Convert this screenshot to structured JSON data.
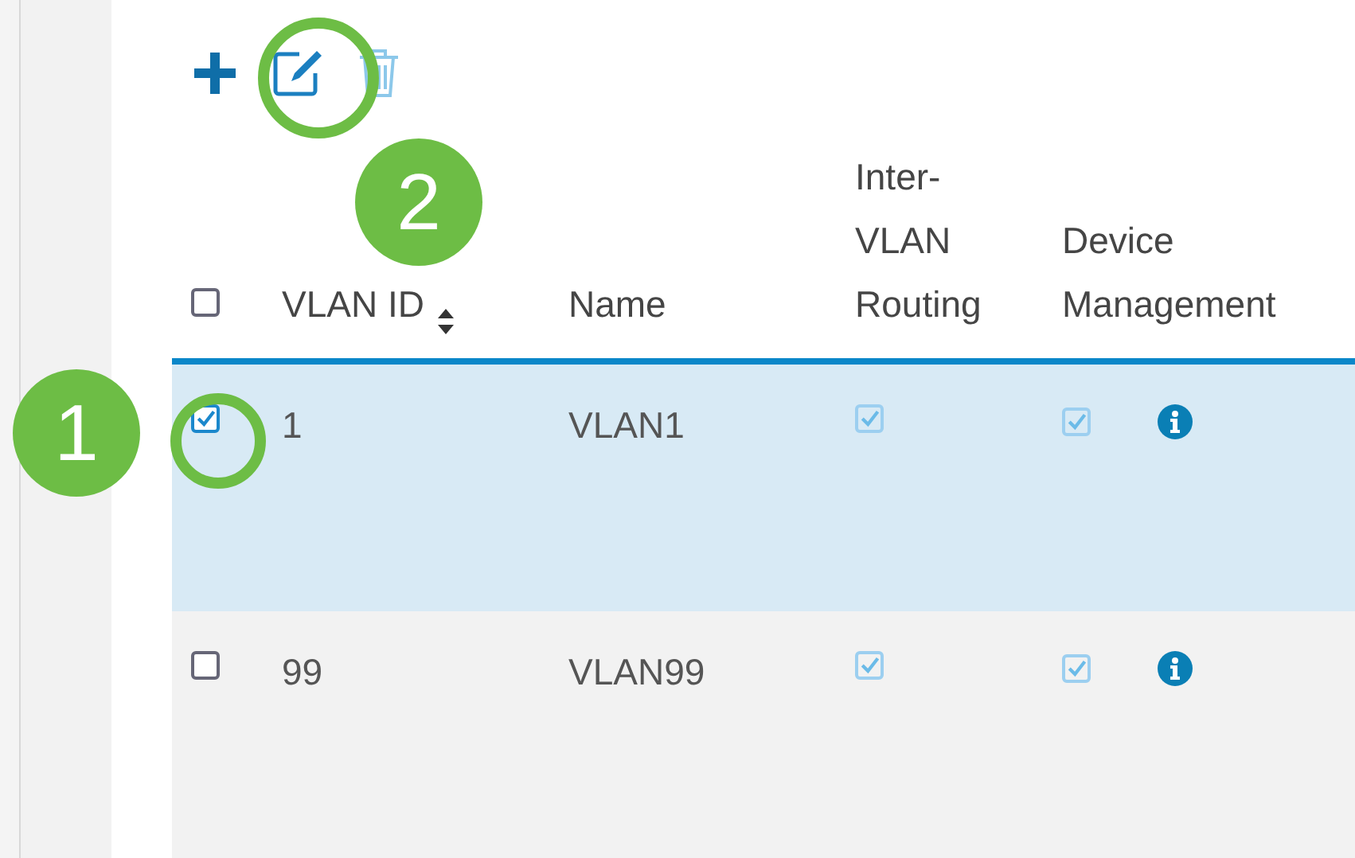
{
  "toolbar": {
    "buttons": [
      {
        "kind": "add",
        "disabled": false
      },
      {
        "kind": "edit",
        "disabled": false
      },
      {
        "kind": "delete",
        "disabled": true
      }
    ]
  },
  "table": {
    "select_all_checked": false,
    "columns": [
      {
        "label": "VLAN ID",
        "sortable": true
      },
      {
        "label": "Name",
        "sortable": false
      },
      {
        "label": "Inter-VLAN Routing",
        "sortable": false
      },
      {
        "label": "Device Management",
        "sortable": false
      }
    ],
    "rows": [
      {
        "selected": true,
        "checked": true,
        "vlan_id": "1",
        "name": "VLAN1",
        "inter_vlan_routing": true,
        "device_management": true
      },
      {
        "selected": false,
        "checked": false,
        "vlan_id": "99",
        "name": "VLAN99",
        "inter_vlan_routing": true,
        "device_management": true
      }
    ]
  },
  "callouts": [
    {
      "number": "1"
    },
    {
      "number": "2"
    }
  ]
}
